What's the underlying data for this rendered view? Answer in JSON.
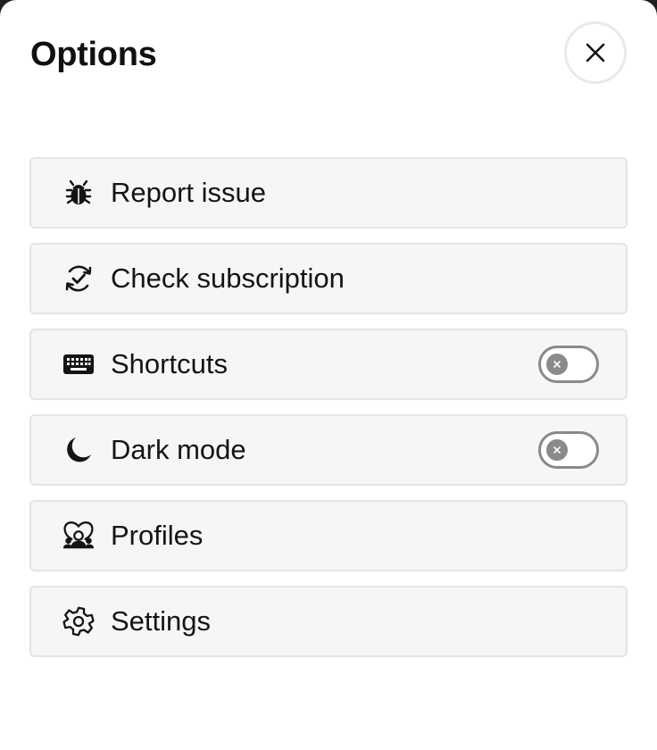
{
  "header": {
    "title": "Options",
    "close_icon": "close-icon"
  },
  "menu": {
    "items": [
      {
        "label": "Report issue",
        "icon": "bug-icon"
      },
      {
        "label": "Check subscription",
        "icon": "refresh-check-icon"
      },
      {
        "label": "Shortcuts",
        "icon": "keyboard-icon",
        "toggle": {
          "on": false
        }
      },
      {
        "label": "Dark mode",
        "icon": "moon-icon",
        "toggle": {
          "on": false
        }
      },
      {
        "label": "Profiles",
        "icon": "profiles-icon"
      },
      {
        "label": "Settings",
        "icon": "settings-icon"
      }
    ]
  },
  "colors": {
    "text": "#141414",
    "item_background": "#f6f6f6",
    "item_border": "#e4e4e4",
    "toggle_off": "#8a8a8a"
  }
}
